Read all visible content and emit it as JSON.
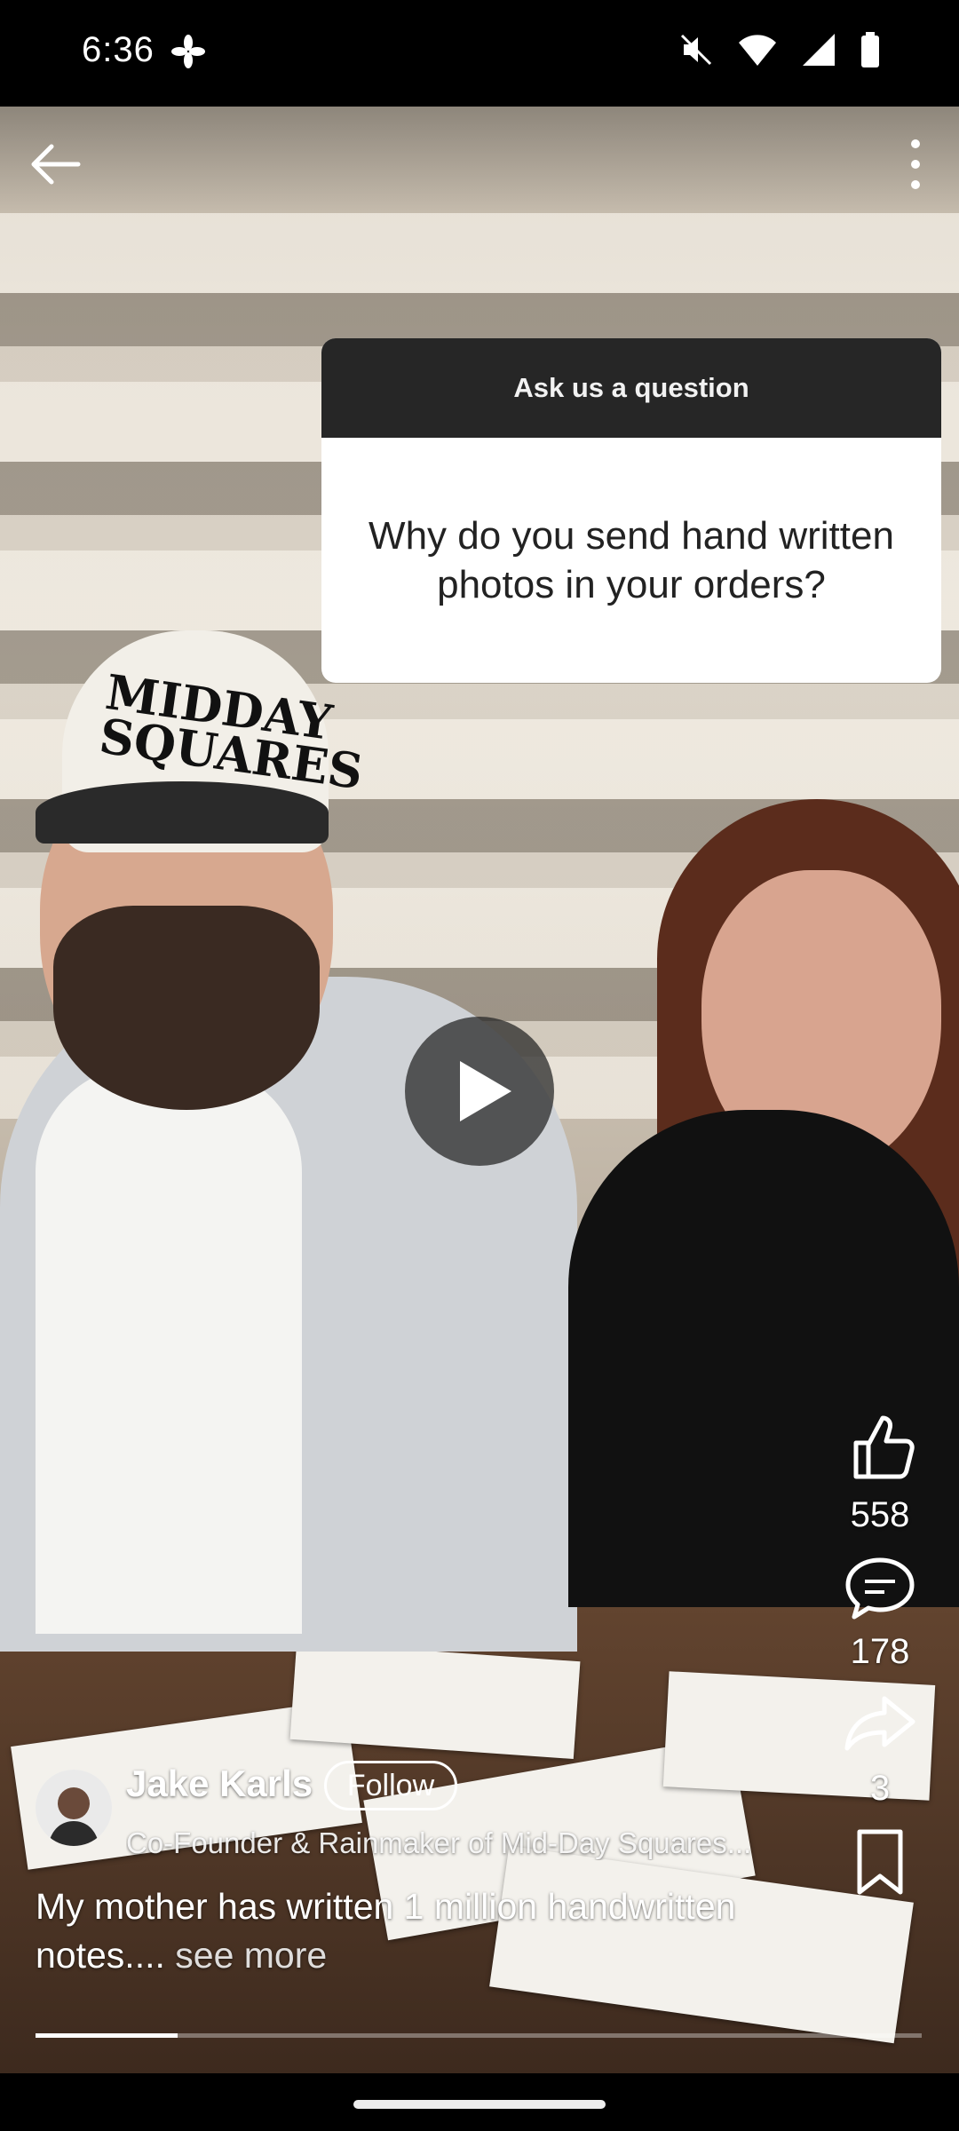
{
  "status_bar": {
    "time": "6:36"
  },
  "video": {
    "sticker": {
      "header": "Ask us a question",
      "question": "Why do you send hand written photos in your orders?"
    },
    "cap_text": "MIDDAY SQUARES",
    "progress_fraction": 0.16
  },
  "actions": {
    "like_count": "558",
    "comment_count": "178",
    "share_count": "3"
  },
  "author": {
    "name": "Jake Karls",
    "follow_label": "Follow",
    "headline": "Co-Founder & Rainmaker of Mid-Day Squares..."
  },
  "caption": {
    "text": "My mother has written 1 million handwritten notes....",
    "see_more": "see more"
  },
  "icons": [
    "back-arrow-icon",
    "more-vert-icon",
    "play-icon",
    "like-icon",
    "comment-icon",
    "share-icon",
    "bookmark-icon"
  ]
}
